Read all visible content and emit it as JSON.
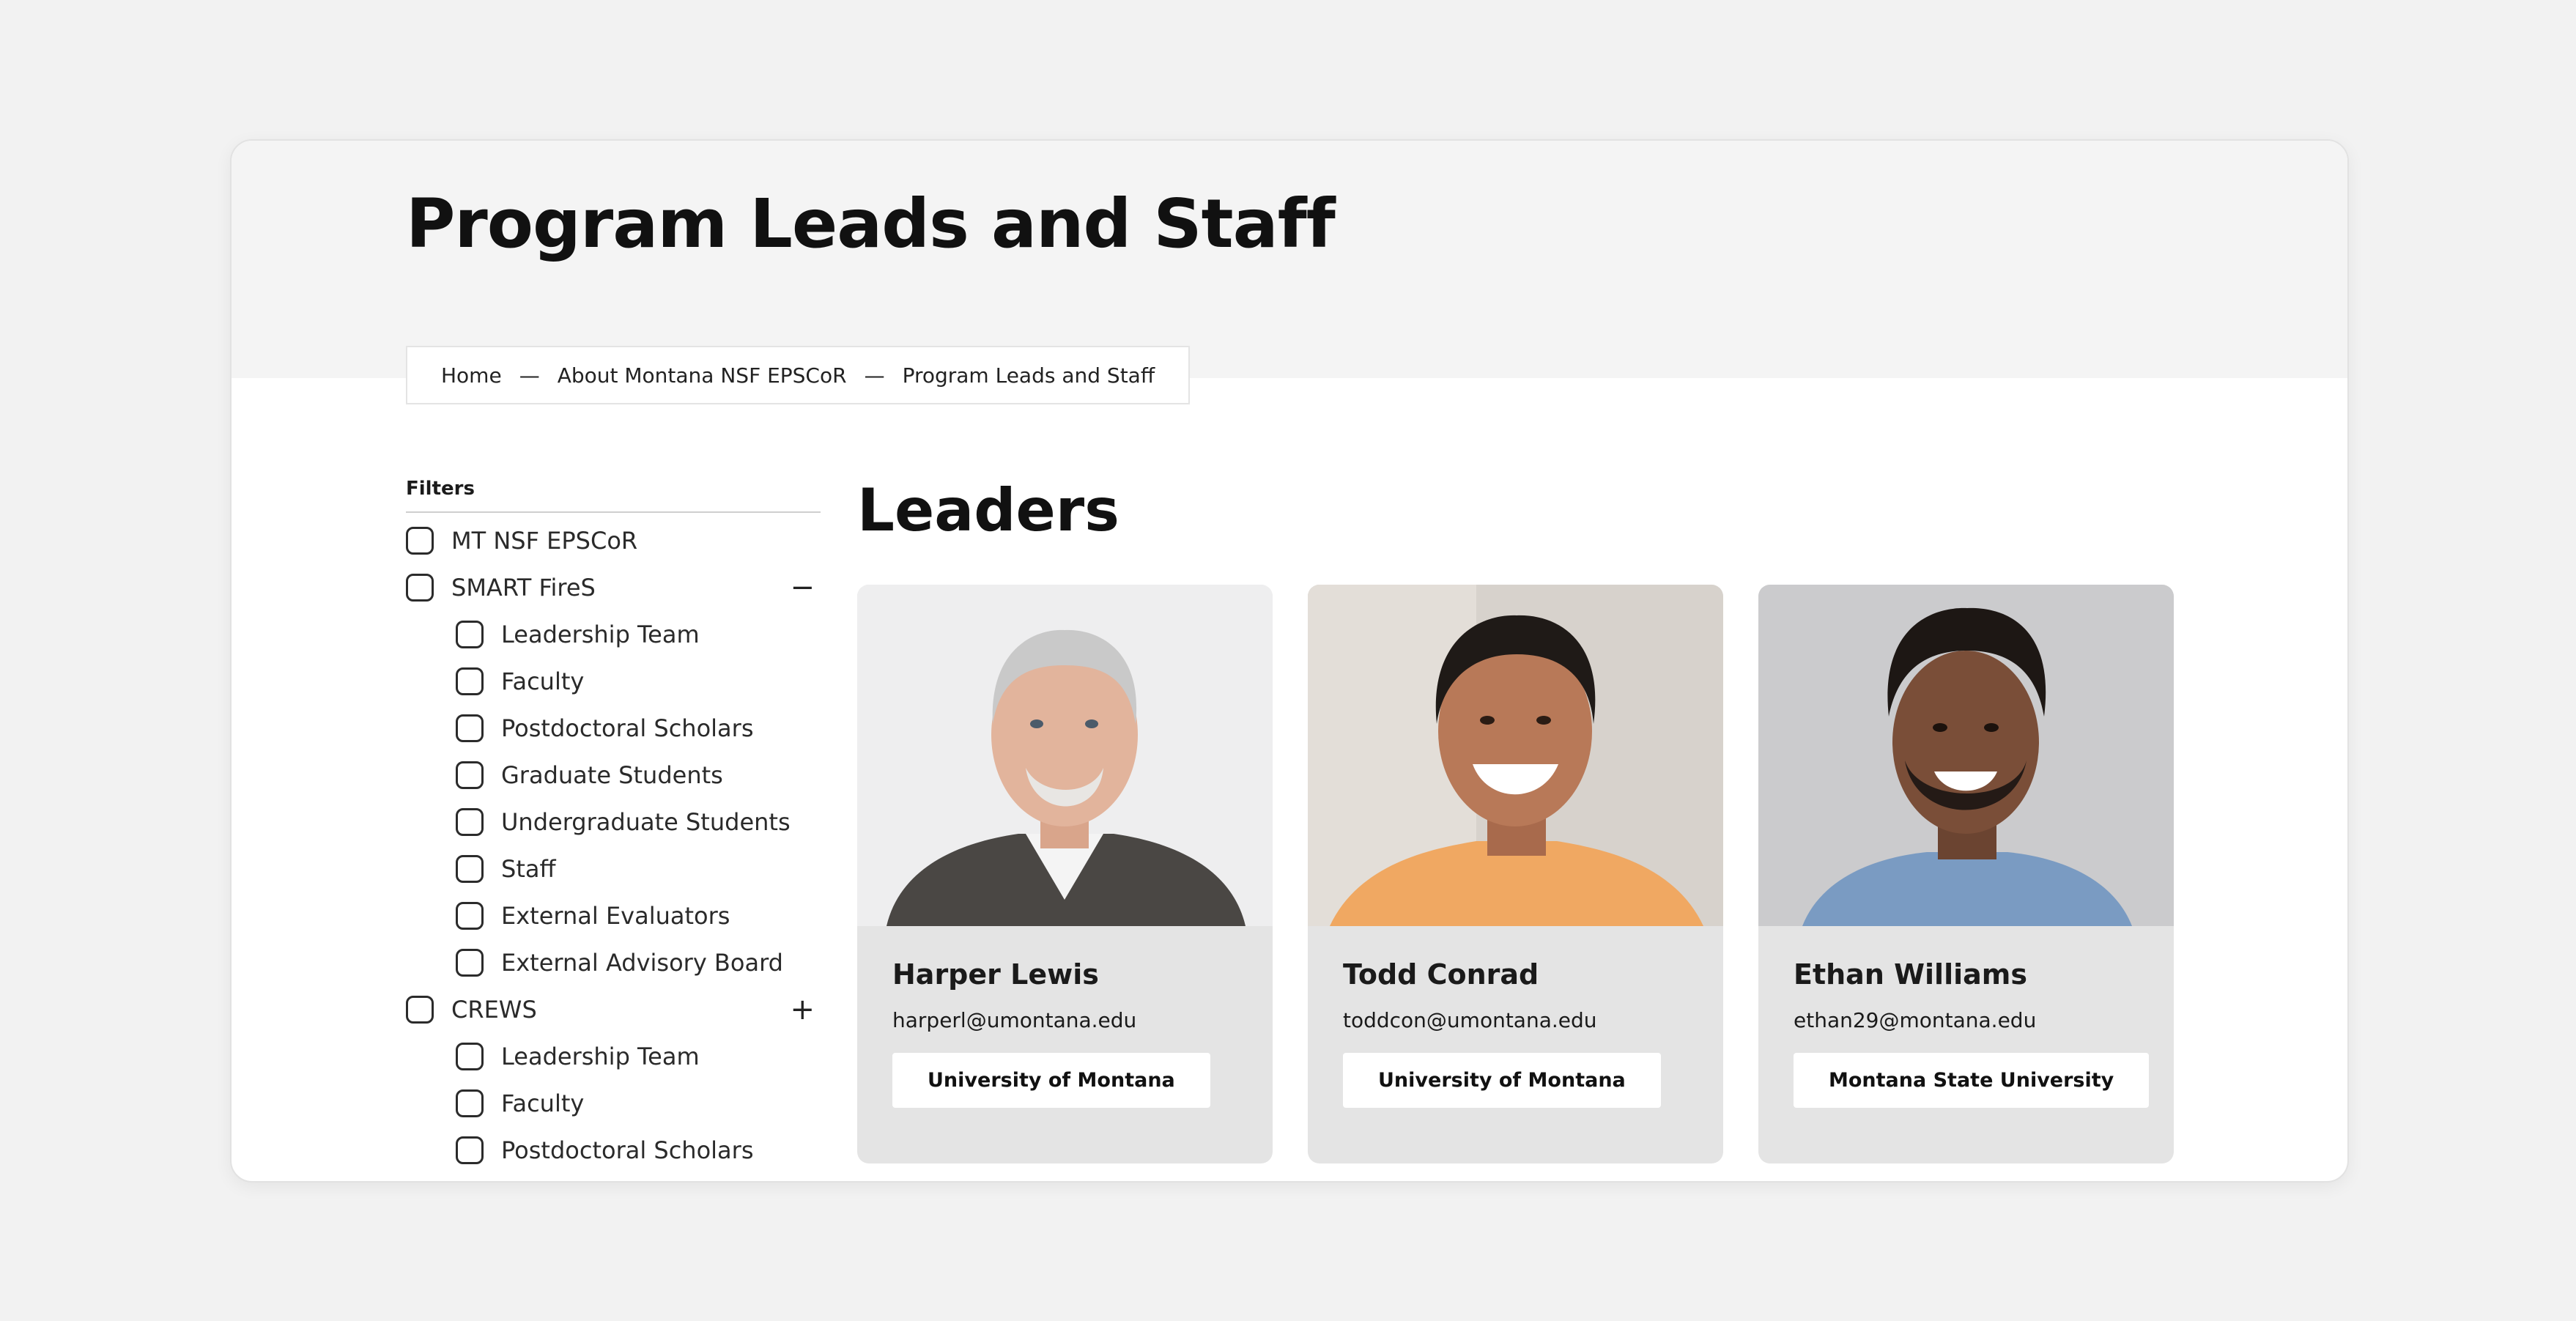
{
  "page": {
    "title": "Program Leads and Staff",
    "breadcrumb": [
      "Home",
      "About Montana NSF EPSCoR",
      "Program Leads and Staff"
    ],
    "breadcrumb_separator": "—"
  },
  "filters": {
    "heading": "Filters",
    "groups": [
      {
        "label": "MT NSF EPSCoR",
        "toggle": "",
        "children": []
      },
      {
        "label": "SMART FireS",
        "toggle": "−",
        "children": [
          "Leadership Team",
          "Faculty",
          "Postdoctoral Scholars",
          "Graduate Students",
          "Undergraduate Students",
          "Staff",
          "External Evaluators",
          "External Advisory Board"
        ]
      },
      {
        "label": "CREWS",
        "toggle": "+",
        "children": [
          "Leadership Team",
          "Faculty",
          "Postdoctoral Scholars"
        ]
      }
    ]
  },
  "leaders": {
    "heading": "Leaders",
    "people": [
      {
        "name": "Harper Lewis",
        "email": "harperl@umontana.edu",
        "institution": "University of Montana"
      },
      {
        "name": "Todd Conrad",
        "email": "toddcon@umontana.edu",
        "institution": "University of Montana"
      },
      {
        "name": "Ethan Williams",
        "email": "ethan29@montana.edu",
        "institution": "Montana State University"
      }
    ]
  },
  "colors": {
    "page_background": "#f2f2f2",
    "hero_background": "#f4f4f4",
    "card_background": "#e4e4e4"
  }
}
